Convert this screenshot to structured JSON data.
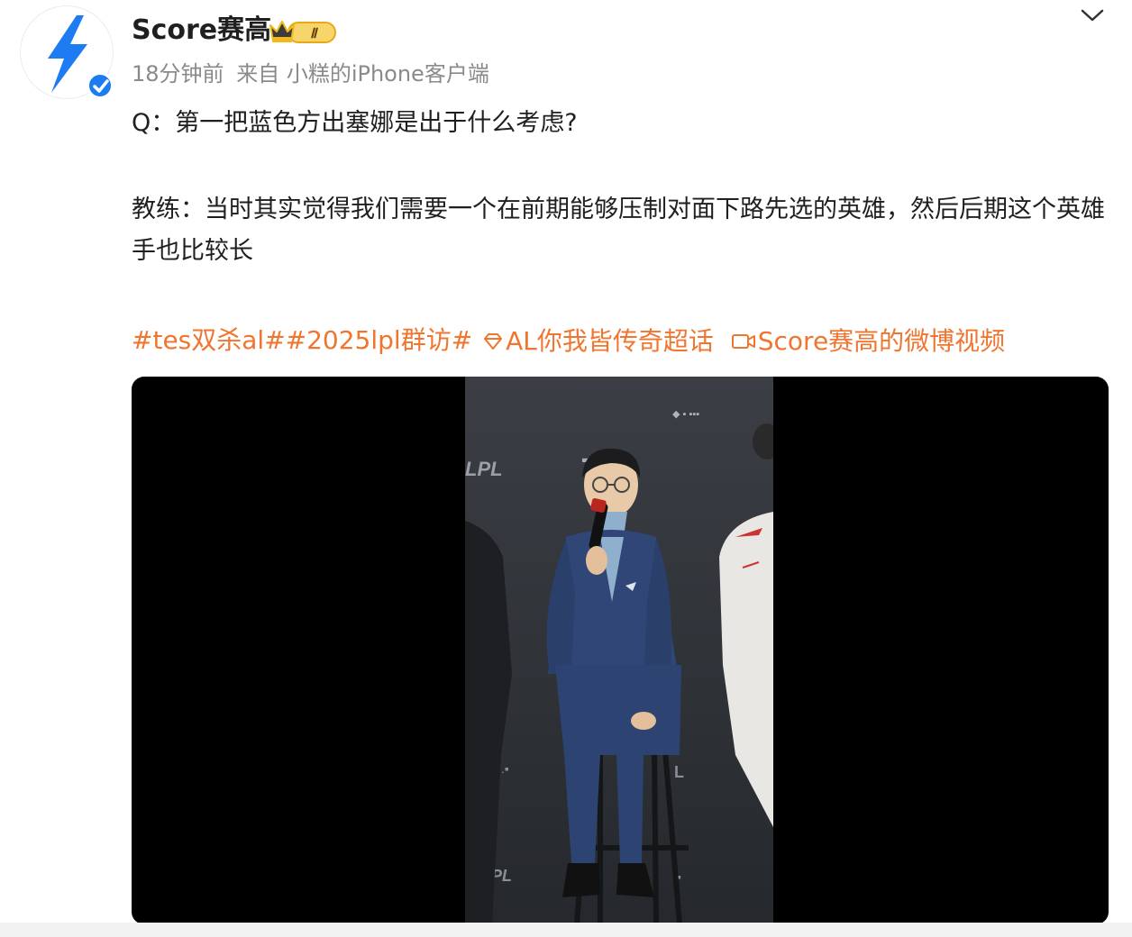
{
  "user": {
    "name": "Score赛高",
    "level_badge": "Ⅱ",
    "verified": true
  },
  "meta": {
    "time": "18分钟前",
    "source": "来自 小糕的iPhone客户端"
  },
  "post": {
    "question": "Q：第一把蓝色方出塞娜是出于什么考虑?",
    "answer": "教练：当时其实觉得我们需要一个在前期能够压制对面下路先选的英雄，然后后期这个英雄手也比较长",
    "tags": {
      "tag1": "#tes双杀al#",
      "tag2": "#2025lpl群访#",
      "super_topic": "AL你我皆传奇超话",
      "video_link": "Score赛高的微博视频"
    }
  },
  "video": {
    "backdrop_logo_1": "LPL",
    "backdrop_logo_2": "LPL",
    "backdrop_logo_3": "LPL"
  },
  "colors": {
    "accent": "#f0752f",
    "verified": "#1d7cf2",
    "badge": "#f3b81b",
    "text": "#1f1f1f",
    "muted": "#8a8a8a"
  },
  "icons": {
    "avatar": "lightning-bolt-icon",
    "verified": "verified-check-icon",
    "badge": "crown-badge-icon",
    "menu": "chevron-down-icon",
    "super_topic": "diamond-icon",
    "video_link": "video-icon"
  }
}
